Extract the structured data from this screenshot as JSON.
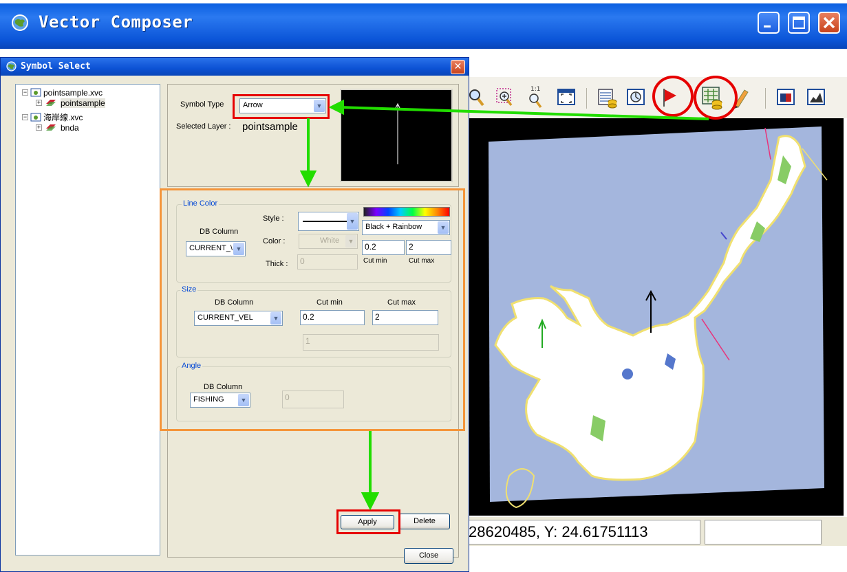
{
  "app": {
    "title": "Vector Composer",
    "window_controls": [
      "minimize",
      "maximize",
      "close"
    ]
  },
  "status_bar": {
    "coordinates": "28620485, Y: 24.61751113"
  },
  "dialog": {
    "title": "Symbol Select",
    "tree": [
      {
        "label": "pointsample.xvc",
        "children": [
          {
            "label": "pointsample"
          }
        ]
      },
      {
        "label": "海岸線.xvc",
        "children": [
          {
            "label": "bnda"
          }
        ]
      }
    ],
    "symbol_type_label": "Symbol Type",
    "symbol_type_value": "Arrow",
    "selected_layer_label": "Selected Layer :",
    "selected_layer_value": "pointsample",
    "line_color": {
      "title": "Line Color",
      "db_column_label": "DB Column",
      "db_column_value": "CURRENT_\\",
      "style_label": "Style :",
      "color_label": "Color :",
      "color_value": "White",
      "thick_label": "Thick :",
      "thick_value": "0",
      "palette_value": "Black + Rainbow",
      "cut_min_value": "0.2",
      "cut_max_value": "2",
      "cut_min_label": "Cut min",
      "cut_max_label": "Cut max"
    },
    "size": {
      "title": "Size",
      "db_column_label": "DB Column",
      "cut_min_label": "Cut min",
      "cut_max_label": "Cut max",
      "db_column_value": "CURRENT_VEL",
      "cut_min_value": "0.2",
      "cut_max_value": "2",
      "fixed_value": "1"
    },
    "angle": {
      "title": "Angle",
      "db_column_label": "DB Column",
      "db_column_value": "FISHING",
      "fixed_value": "0"
    },
    "apply_label": "Apply",
    "delete_label": "Delete",
    "close_label": "Close"
  },
  "colors": {
    "highlight_red": "#e60000",
    "highlight_orange": "#f4953a",
    "arrow_green": "#22dd00",
    "map_sea": "#a4b6dd",
    "xp_blue": "#0a5fe0"
  }
}
